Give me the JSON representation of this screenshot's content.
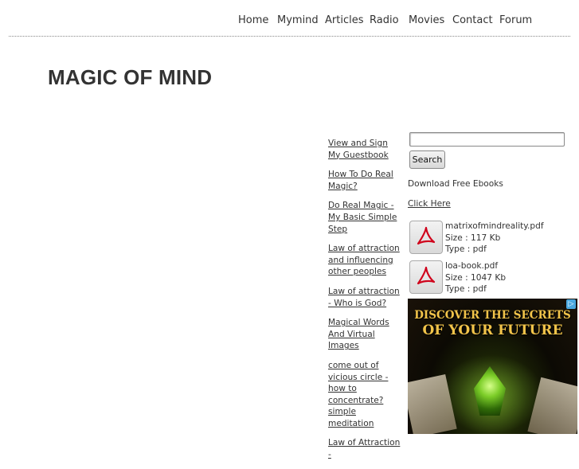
{
  "nav": {
    "items": [
      "Home",
      "Mymind",
      "Articles",
      "Radio",
      "Movies",
      "Contact",
      "Forum"
    ]
  },
  "site": {
    "title": "MAGIC OF MIND"
  },
  "sidebar_links": [
    "View and Sign My Guestbook",
    "How To Do Real Magic?",
    "Do Real Magic - My Basic Simple Step",
    "Law of attraction and influencing other peoples",
    "Law of attraction - Who is God?",
    "Magical Words And Virtual Images",
    "come out of vicious circle - how to concentrate? simple meditation",
    "Law of Attraction -"
  ],
  "search": {
    "placeholder": "",
    "button_label": "Search"
  },
  "ebooks": {
    "heading": "Download Free Ebooks",
    "link_label": "Click Here",
    "files": [
      {
        "name": "matrixofmindreality.pdf",
        "size": "Size : 117 Kb",
        "type": "Type : pdf",
        "icon": "pdf-icon"
      },
      {
        "name": "loa-book.pdf",
        "size": "Size : 1047 Kb",
        "type": "Type : pdf",
        "icon": "pdf-icon"
      }
    ]
  },
  "ad": {
    "line1": "DISCOVER THE SECRETS",
    "line2": "OF YOUR FUTURE",
    "adchoices_icon": "adchoices-icon"
  },
  "colors": {
    "text": "#333333",
    "ad_gold": "#f2c44a",
    "pdf_red": "#d0021b"
  }
}
